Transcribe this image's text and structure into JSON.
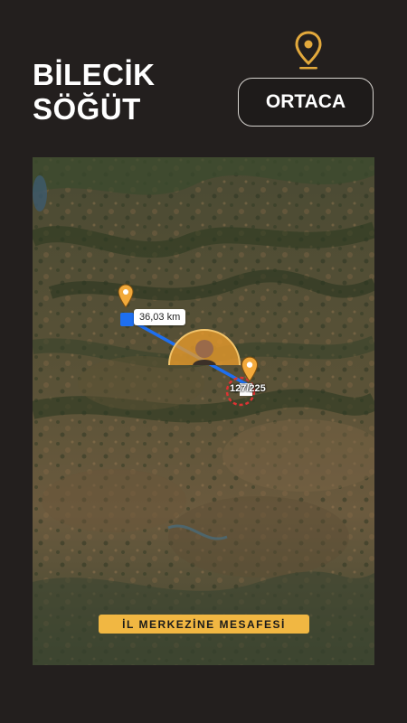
{
  "header": {
    "title_line1": "BİLECİK",
    "title_line2": "SÖĞÜT",
    "level_button": "ORTACA"
  },
  "map": {
    "distance_label": "36,03 km",
    "counter": "127/225",
    "banner": "İL MERKEZİNE MESAFESİ"
  },
  "icons": {
    "top_pin": "location-pin-icon",
    "origin_pin": "location-pin-icon",
    "target_pin": "location-pin-icon"
  },
  "colors": {
    "background": "#231f1e",
    "accent": "#f1b742",
    "route": "#1e6ff0",
    "pin": "#f2a93b"
  }
}
